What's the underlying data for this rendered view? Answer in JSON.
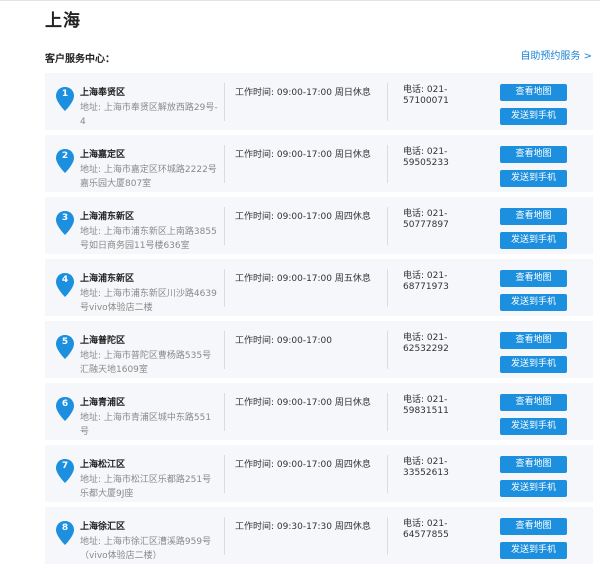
{
  "page": {
    "city_title": "上海",
    "section_title": "客户服务中心：",
    "booking_link": "自助预约服务 >",
    "accent_color": "#1c8fde"
  },
  "stores": [
    {
      "index": "1",
      "name": "上海奉贤区",
      "address": "地址: 上海市奉贤区解放西路29号-4",
      "hours": "工作时间: 09:00-17:00 周日休息",
      "phone": "电话: 021-57100071",
      "map_label": "查看地图",
      "send_label": "发送到手机"
    },
    {
      "index": "2",
      "name": "上海嘉定区",
      "address": "地址: 上海市嘉定区环城路2222号嘉乐园大厦807室",
      "hours": "工作时间: 09:00-17:00 周日休息",
      "phone": "电话: 021-59505233",
      "map_label": "查看地图",
      "send_label": "发送到手机"
    },
    {
      "index": "3",
      "name": "上海浦东新区",
      "address": "地址: 上海市浦东新区上南路3855号如日商务园11号楼636室",
      "hours": "工作时间: 09:00-17:00 周四休息",
      "phone": "电话: 021-50777897",
      "map_label": "查看地图",
      "send_label": "发送到手机"
    },
    {
      "index": "4",
      "name": "上海浦东新区",
      "address": "地址: 上海市浦东新区川沙路4639号vivo体验店二楼",
      "hours": "工作时间: 09:00-17:00 周五休息",
      "phone": "电话: 021-68771973",
      "map_label": "查看地图",
      "send_label": "发送到手机"
    },
    {
      "index": "5",
      "name": "上海普陀区",
      "address": "地址: 上海市普陀区曹杨路535号汇融天地1609室",
      "hours": "工作时间: 09:00-17:00",
      "phone": "电话: 021-62532292",
      "map_label": "查看地图",
      "send_label": "发送到手机"
    },
    {
      "index": "6",
      "name": "上海青浦区",
      "address": "地址: 上海市青浦区城中东路551号",
      "hours": "工作时间: 09:00-17:00 周日休息",
      "phone": "电话: 021-59831511",
      "map_label": "查看地图",
      "send_label": "发送到手机"
    },
    {
      "index": "7",
      "name": "上海松江区",
      "address": "地址: 上海市松江区乐都路251号乐都大厦9J座",
      "hours": "工作时间: 09:00-17:00 周四休息",
      "phone": "电话: 021-33552613",
      "map_label": "查看地图",
      "send_label": "发送到手机"
    },
    {
      "index": "8",
      "name": "上海徐汇区",
      "address": "地址: 上海市徐汇区漕溪路959号（vivo体验店二楼）",
      "hours": "工作时间: 09:30-17:30 周四休息",
      "phone": "电话: 021-64577855",
      "map_label": "查看地图",
      "send_label": "发送到手机"
    }
  ]
}
